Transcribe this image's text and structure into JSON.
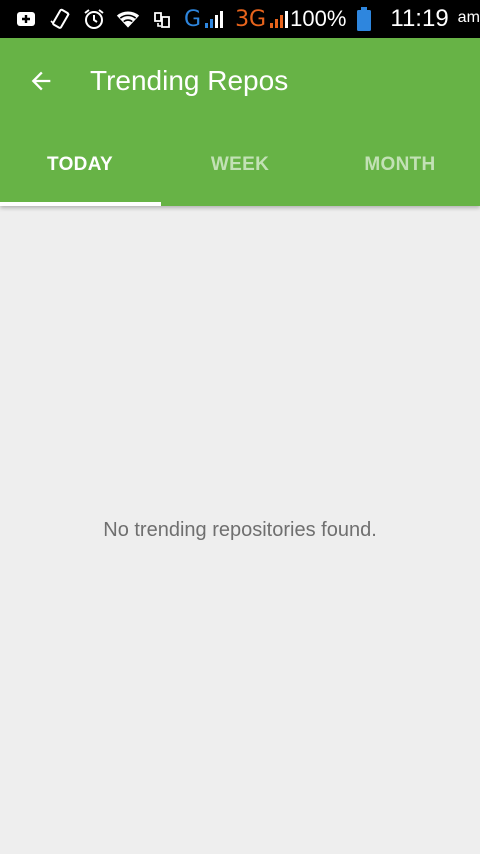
{
  "status_bar": {
    "network_g": "G",
    "network_3g": "3G",
    "battery": "100%",
    "time": "11:19",
    "ampm": "am",
    "icons": [
      "usb-icon",
      "vibrate-icon",
      "alarm-icon",
      "wifi-icon",
      "phone-data-icon",
      "signal-icon",
      "battery-icon"
    ]
  },
  "appbar": {
    "title": "Trending Repos",
    "back_icon": "arrow-back-icon",
    "color": "#67b346"
  },
  "tabs": [
    {
      "label": "TODAY",
      "active": true
    },
    {
      "label": "WEEK",
      "active": false
    },
    {
      "label": "MONTH",
      "active": false
    }
  ],
  "content": {
    "empty_message": "No trending repositories found."
  }
}
